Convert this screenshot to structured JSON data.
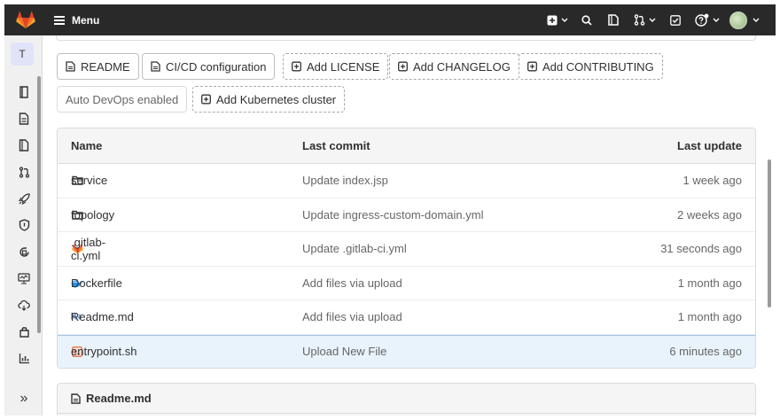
{
  "nav": {
    "menu_label": "Menu",
    "icons": [
      "gitlab-logo",
      "plus-square-icon",
      "search-icon",
      "issues-icon",
      "merge-request-icon",
      "todo-icon",
      "help-icon",
      "avatar"
    ]
  },
  "sidebar": {
    "project_letter": "T",
    "items": [
      "repository-icon",
      "issues-icon",
      "merge-requests-icon",
      "git-branch-icon",
      "rocket-icon",
      "shield-icon",
      "deployments-icon",
      "monitor-icon",
      "infrastructure-icon",
      "package-icon",
      "analytics-icon"
    ],
    "collapse_label": "»"
  },
  "buttons": {
    "readme": "README",
    "cicd": "CI/CD configuration",
    "add_license": "Add LICENSE",
    "add_changelog": "Add CHANGELOG",
    "add_contributing": "Add CONTRIBUTING",
    "autodevops": "Auto DevOps enabled",
    "add_k8s": "Add Kubernetes cluster"
  },
  "table": {
    "headers": {
      "name": "Name",
      "commit": "Last commit",
      "update": "Last update"
    },
    "rows": [
      {
        "name": "service",
        "icon": "folder-icon",
        "commit": "Update index.jsp",
        "update": "1 week ago"
      },
      {
        "name": "topology",
        "icon": "folder-icon",
        "commit": "Update ingress-custom-domain.yml",
        "update": "2 weeks ago"
      },
      {
        "name": ".gitlab-ci.yml",
        "icon": "gitlab-file-icon",
        "commit": "Update .gitlab-ci.yml",
        "update": "31 seconds ago"
      },
      {
        "name": "Dockerfile",
        "icon": "docker-icon",
        "commit": "Add files via upload",
        "update": "1 month ago"
      },
      {
        "name": "Readme.md",
        "icon": "markdown-icon",
        "commit": "Add files via upload",
        "update": "1 month ago"
      },
      {
        "name": "entrypoint.sh",
        "icon": "terminal-file-icon",
        "commit": "Upload New File",
        "update": "6 minutes ago"
      }
    ]
  },
  "readme_panel": {
    "title": "Readme.md"
  },
  "colors": {
    "topbar": "#292929",
    "highlight_row": "#e9f3fc",
    "gitlab_orange": "#fc6d26",
    "docker_blue": "#2496ed"
  }
}
